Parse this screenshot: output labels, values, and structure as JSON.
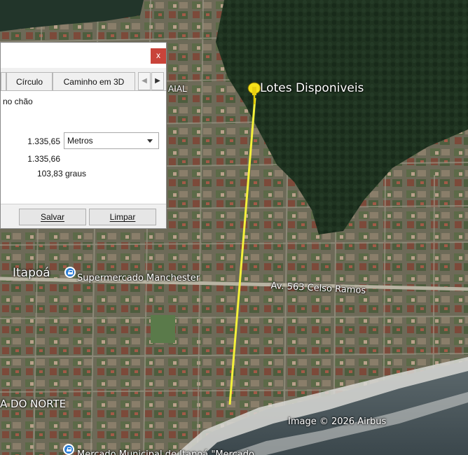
{
  "map": {
    "placemark_label": "Lotes  Disponiveis",
    "town_label": "Itapoá",
    "partial_locality_label": "AIAL",
    "district_label": "A DO NORTE",
    "poi_supermarket": "Supermercado Manchester",
    "street_label": "Av. 563 Celso Ramos",
    "poi_bottom_partial": "Mercado Municipal de Itapoá \"Mercado",
    "attribution": "Image © 2026 Airbus",
    "measure_line_color": "#f4f13a",
    "placemark_color": "#f6e21a"
  },
  "dialog": {
    "close_label": "x",
    "tabs": [
      "Círculo",
      "Caminho em 3D"
    ],
    "tab_prev": "◀",
    "tab_next": "▶",
    "ground_label": "no chão",
    "ground_length": "1.335,65",
    "unit": "Metros",
    "map_length": "1.335,66",
    "heading": "103,83 graus",
    "save_label": "Salvar",
    "clear_label": "Limpar"
  }
}
